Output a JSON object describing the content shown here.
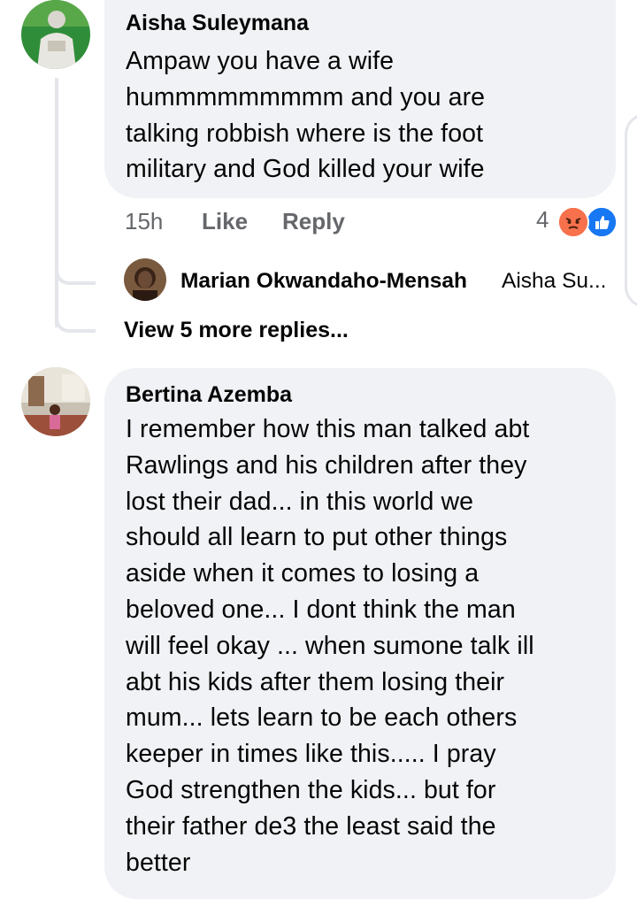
{
  "comments": [
    {
      "author": "Aisha Suleymana",
      "lines": [
        "Ampaw you have a wife",
        "hummmmmmmmm and you are",
        "talking robbish where is the foot",
        "military and God killed your wife"
      ],
      "time": "15h",
      "like_label": "Like",
      "reply_label": "Reply",
      "reaction_count": "4",
      "reaction_icons": [
        "angry-reaction-icon",
        "like-reaction-icon"
      ],
      "reply_preview": {
        "author": "Marian Okwandaho-Mensah",
        "snippet": "Aisha Su..."
      },
      "view_more_label": "View 5 more replies..."
    },
    {
      "author": "Bertina Azemba",
      "lines": [
        "I remember  how this man talked abt",
        "Rawlings  and his children  after they",
        "lost their dad... in this world we",
        "should  all learn to put other things",
        "aside when it comes  to losing  a",
        "beloved  one... I dont think the man",
        "will feel okay ... when sumone  talk  ill",
        "abt his kids after them losing  their",
        "mum... lets learn to be each others",
        "keeper in times like this.....  I pray",
        "God strengthen  the kids... but for",
        "their father de3  the least said the",
        "better"
      ]
    }
  ],
  "colors": {
    "bubble": "#f0f2f5",
    "meta_text": "#65676b",
    "angry": "#f7714c",
    "like": "#1877f2"
  }
}
